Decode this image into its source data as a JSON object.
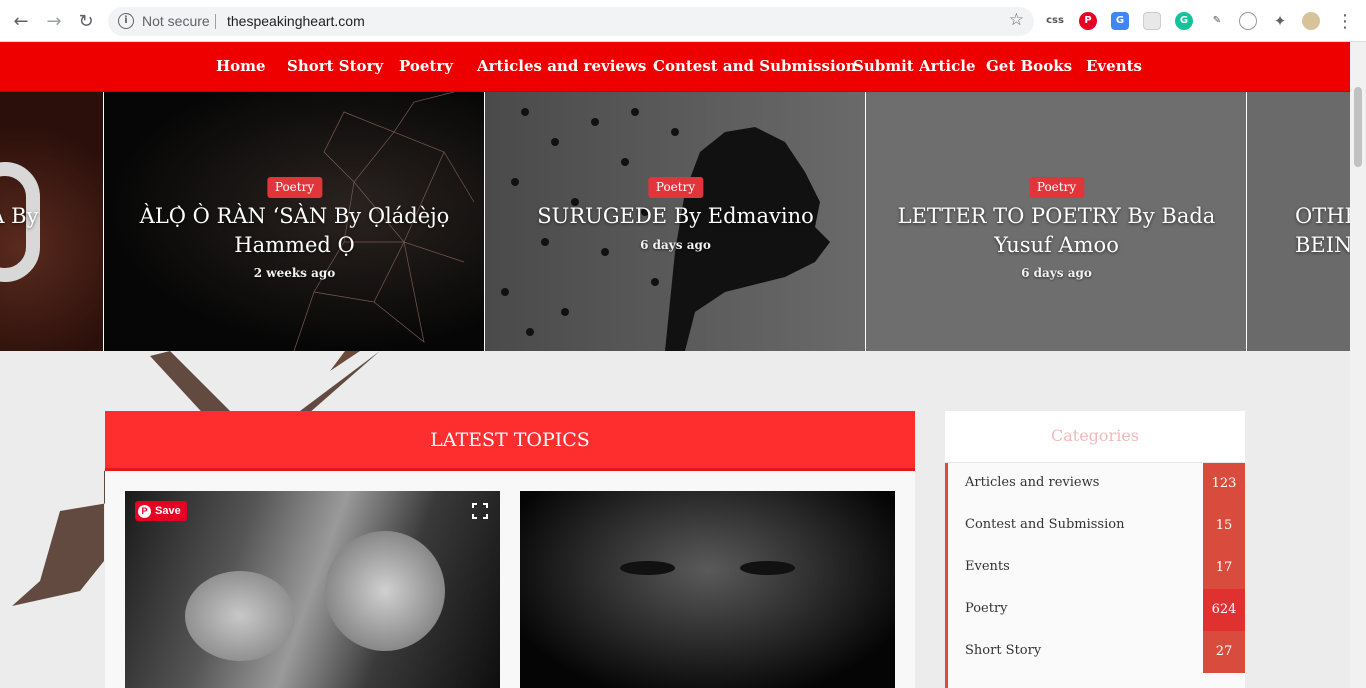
{
  "browser": {
    "security_label": "Not secure",
    "url": "thespeakingheart.com",
    "extensions": [
      "css-icon",
      "pinterest-icon",
      "translate-icon",
      "ext-icon",
      "grammarly-icon",
      "eyedropper-icon",
      "ext-icon",
      "puzzle-icon",
      "profile-avatar"
    ]
  },
  "nav": {
    "items": [
      "Home",
      "Short Story",
      "Poetry",
      "Articles and reviews",
      "Contest and Submission",
      "Submit Article",
      "Get Books",
      "Events"
    ]
  },
  "slides": [
    {
      "badge": "",
      "title": "TEA By",
      "time": ""
    },
    {
      "badge": "Poetry",
      "title": "ÀLỌ̀ Ò RÀN ‘SÀN By Ọládèjọ Hammed Ọ",
      "time": "2 weeks ago"
    },
    {
      "badge": "Poetry",
      "title": "SURUGEDE By Edmavino",
      "time": "6 days ago"
    },
    {
      "badge": "Poetry",
      "title": "LETTER TO POETRY By Bada Yusuf Amoo",
      "time": "6 days ago"
    },
    {
      "badge": "",
      "title": "OTHE BEIN",
      "time": ""
    }
  ],
  "latest": {
    "heading": "LATEST TOPICS",
    "save_label": "Save"
  },
  "categories": {
    "heading": "Categories",
    "items": [
      {
        "name": "Articles and reviews",
        "count": "123"
      },
      {
        "name": "Contest and Submission",
        "count": "15"
      },
      {
        "name": "Events",
        "count": "17"
      },
      {
        "name": "Poetry",
        "count": "624"
      },
      {
        "name": "Short Story",
        "count": "27"
      }
    ]
  },
  "colors": {
    "nav_red": "#ee0000",
    "topic_header": "#ff2e2e",
    "category_accent": "#d94c3d",
    "badge": "#e0353b"
  }
}
